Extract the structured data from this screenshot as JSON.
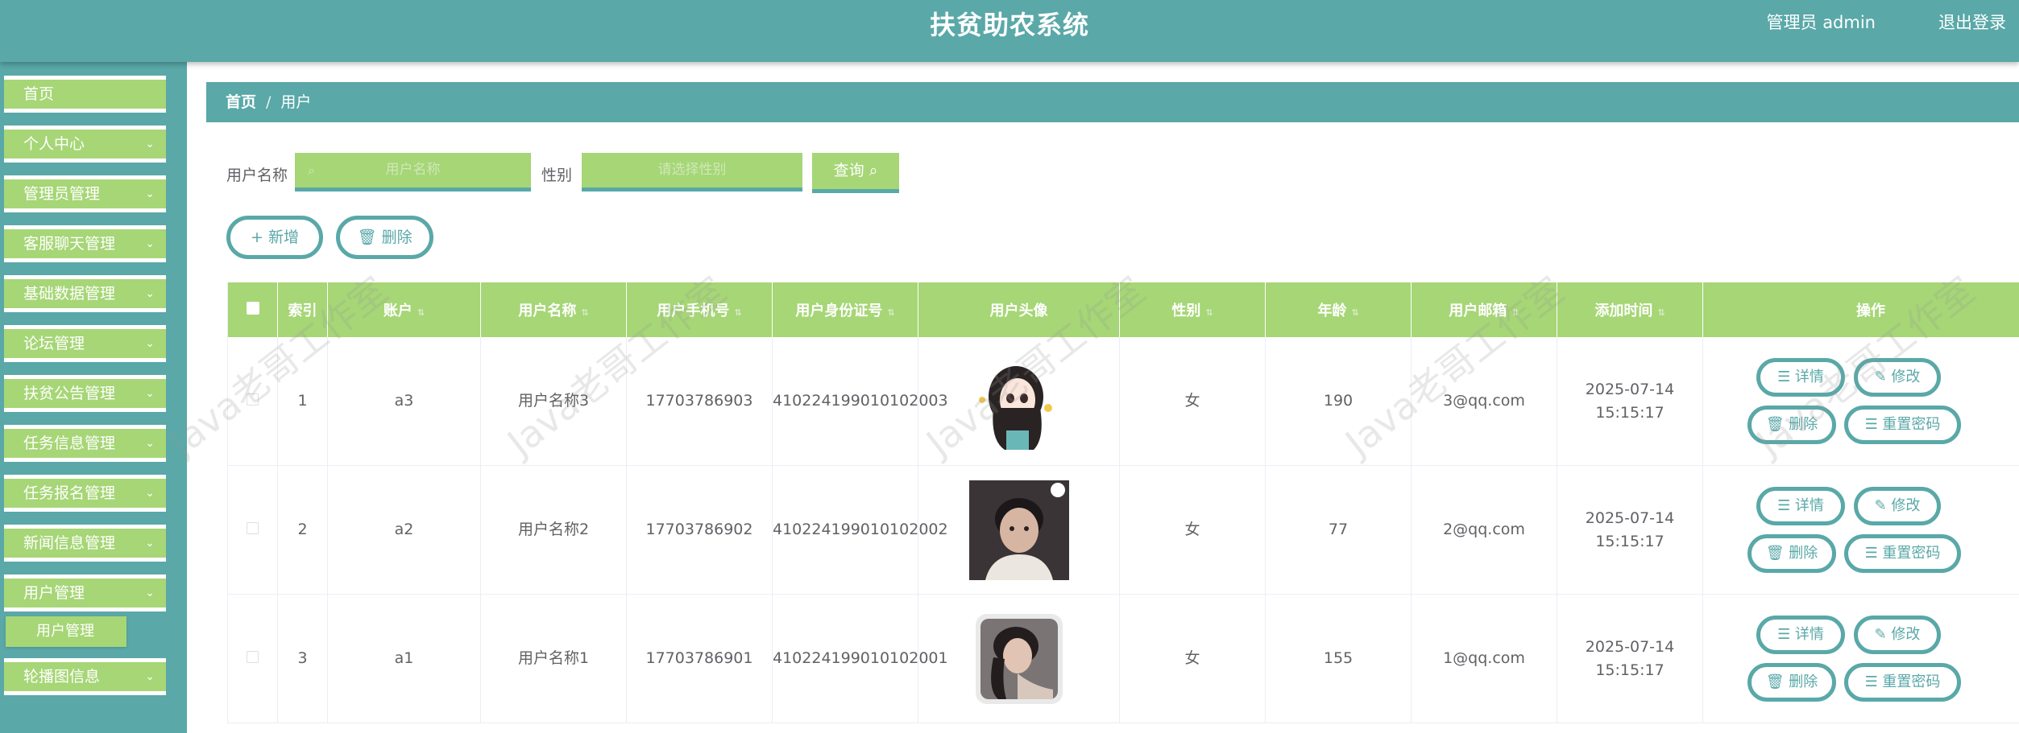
{
  "header": {
    "title": "扶贫助农系统",
    "user": "管理员 admin",
    "logout": "退出登录"
  },
  "sidebar": {
    "items": [
      {
        "label": "首页"
      },
      {
        "label": "个人中心"
      },
      {
        "label": "管理员管理"
      },
      {
        "label": "客服聊天管理"
      },
      {
        "label": "基础数据管理"
      },
      {
        "label": "论坛管理"
      },
      {
        "label": "扶贫公告管理"
      },
      {
        "label": "任务信息管理"
      },
      {
        "label": "任务报名管理"
      },
      {
        "label": "新闻信息管理"
      },
      {
        "label": "用户管理"
      },
      {
        "label": "轮播图信息"
      }
    ],
    "submenu": {
      "label": "用户管理"
    }
  },
  "breadcrumb": {
    "home": "首页",
    "sep": "/",
    "current": "用户"
  },
  "search": {
    "name_label": "用户名称",
    "name_placeholder": "用户名称",
    "gender_label": "性别",
    "gender_placeholder": "请选择性别",
    "button": "查询 ⌕"
  },
  "actions": {
    "add": "+ 新增",
    "delete": "🗑 删除"
  },
  "table": {
    "headers": [
      "索引",
      "账户",
      "用户名称",
      "用户手机号",
      "用户身份证号",
      "用户头像",
      "性别",
      "年龄",
      "用户邮箱",
      "添加时间",
      "操作"
    ],
    "rows": [
      {
        "index": "1",
        "account": "a3",
        "name": "用户名称3",
        "phone": "17703786903",
        "id_card": "410224199010102003",
        "gender": "女",
        "age": "190",
        "email": "3@qq.com",
        "time": "2025-07-14 15:15:17"
      },
      {
        "index": "2",
        "account": "a2",
        "name": "用户名称2",
        "phone": "17703786902",
        "id_card": "410224199010102002",
        "gender": "女",
        "age": "77",
        "email": "2@qq.com",
        "time": "2025-07-14 15:15:17"
      },
      {
        "index": "3",
        "account": "a1",
        "name": "用户名称1",
        "phone": "17703786901",
        "id_card": "410224199010102001",
        "gender": "女",
        "age": "155",
        "email": "1@qq.com",
        "time": "2025-07-14 15:15:17"
      }
    ],
    "ops": {
      "detail": "☰ 详情",
      "edit": "✎ 修改",
      "delete": "🗑 删除",
      "reset": "☰ 重置密码"
    }
  },
  "watermark": "Java老哥工作室",
  "colors": {
    "primary": "#5aa8a8",
    "accent": "#a6d676"
  }
}
